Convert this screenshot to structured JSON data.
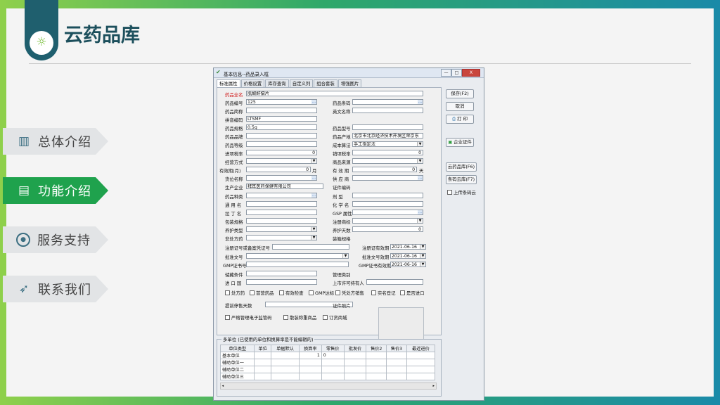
{
  "slide": {
    "app_title": "云药品库",
    "nav": [
      {
        "label": "总体介绍",
        "icon": "bar-chart-icon",
        "active": false
      },
      {
        "label": "功能介绍",
        "icon": "document-icon",
        "active": true
      },
      {
        "label": "服务支持",
        "icon": "target-icon",
        "active": false
      },
      {
        "label": "联系我们",
        "icon": "rocket-icon",
        "active": false
      }
    ]
  },
  "window": {
    "title": "基本信息--药品录入框",
    "tabs": [
      "标准属性",
      "价格设置",
      "库存查询",
      "自定义列",
      "组合套装",
      "增强图片"
    ],
    "fields": {
      "drug_fullname": {
        "label": "药品全名",
        "value": "肌酸酐偿片"
      },
      "drug_code": {
        "label": "药品编号",
        "value": "125"
      },
      "drug_barcode": {
        "label": "药品条码",
        "value": ""
      },
      "drug_shortname": {
        "label": "药品简称",
        "value": ""
      },
      "english_name": {
        "label": "英文名称",
        "value": ""
      },
      "pinyin_code": {
        "label": "拼音编码",
        "value": "LTSMF"
      },
      "spec": {
        "label": "药品规格",
        "value": "0.5g"
      },
      "model": {
        "label": "药品型号",
        "value": ""
      },
      "brand": {
        "label": "药品品牌",
        "value": ""
      },
      "origin": {
        "label": "药品产地",
        "value": "北京市北京经济技术开发区荣京东"
      },
      "grade": {
        "label": "药品等级",
        "value": ""
      },
      "cost_method": {
        "label": "成本算法",
        "value": "手工指定法"
      },
      "input_tax": {
        "label": "进项税率",
        "value": "0"
      },
      "output_tax": {
        "label": "销项税率",
        "value": "0"
      },
      "business_mode": {
        "label": "经营方式",
        "value": ""
      },
      "source": {
        "label": "商品来源",
        "value": ""
      },
      "valid_period": {
        "label": "有效期(月)",
        "value": "0",
        "unit": "月"
      },
      "valid_days": {
        "label": "有 效 期",
        "value": "0",
        "unit": "天"
      },
      "location": {
        "label": "货位名称",
        "value": ""
      },
      "supplier": {
        "label": "供 应 商",
        "value": ""
      },
      "manufacturer": {
        "label": "生产企业",
        "value": "拜耳医药保健有限公司"
      },
      "cert_code": {
        "label": "证件编码",
        "value": ""
      },
      "category": {
        "label": "药品种类",
        "value": ""
      },
      "dosage_form": {
        "label": "剂    型",
        "value": ""
      },
      "generic_name": {
        "label": "通 用 名",
        "value": ""
      },
      "chem_name": {
        "label": "化 学 名",
        "value": ""
      },
      "latin_name": {
        "label": "拉 丁 名",
        "value": ""
      },
      "gsp_attr": {
        "label": "GSP 属性",
        "value": ""
      },
      "package_spec": {
        "label": "包装规格",
        "value": ""
      },
      "trademark": {
        "label": "注册商标",
        "value": ""
      },
      "care_type": {
        "label": "养护类型",
        "value": ""
      },
      "care_days": {
        "label": "养护天数",
        "value": "0"
      },
      "non_rx": {
        "label": "非处方药",
        "value": ""
      },
      "box_spec": {
        "label": "装箱规格",
        "value": ""
      },
      "reg_cert": {
        "label": "注册证号或备案凭证号",
        "value": ""
      },
      "reg_valid": {
        "label": "注册证有效期",
        "value": "2021-06-16"
      },
      "approval_no": {
        "label": "批准文号",
        "value": ""
      },
      "approval_valid": {
        "label": "批准文号效期",
        "value": "2021-06-16"
      },
      "gmp_no": {
        "label": "GMP证书号",
        "value": ""
      },
      "gmp_valid": {
        "label": "GMP证书有效期",
        "value": "2021-06-16"
      },
      "storage": {
        "label": "储藏条件",
        "value": ""
      },
      "mgmt_type": {
        "label": "管理类别",
        "value": ""
      },
      "import_country": {
        "label": "进 口 国",
        "value": ""
      },
      "mah": {
        "label": "上市许可持有人",
        "value": ""
      },
      "alert_days": {
        "label": "提前停售天数",
        "value": ""
      },
      "cert_photo": {
        "label": "证件照片"
      }
    },
    "checks_row1": [
      "处方药",
      "首营药品",
      "有效检查",
      "GMP达标",
      "凭处方销售",
      "实名登记",
      "是否进口"
    ],
    "checks_row2": [
      "严格管理电子监管码",
      "散装称重商品",
      "订货商城"
    ],
    "units_group": {
      "title": "多单位 (已使用的单位和换算率是不能编辑的)",
      "columns": [
        "单位类型",
        "单位",
        "单据默认",
        "换算率",
        "零售价",
        "批发价",
        "",
        "售价2",
        "",
        "售价3",
        "最近进价"
      ],
      "rows": [
        {
          "type": "基本单位",
          "rate": "1",
          "retail": "0"
        },
        {
          "type": "辅助单位一",
          "rate": "",
          "retail": ""
        },
        {
          "type": "辅助单位二",
          "rate": "",
          "retail": ""
        },
        {
          "type": "辅助单位三",
          "rate": "",
          "retail": ""
        }
      ]
    },
    "buttons": {
      "save": "保存(F2)",
      "cancel": "取消",
      "print": "打 印",
      "company_cert": "企业证件",
      "cloud_lib": "云药品库(F6)",
      "barcode_cloud": "条码云库(F7)",
      "upload_barcode": "上传条码云"
    },
    "winbtns": {
      "min": "—",
      "max": "□",
      "close": "X"
    }
  }
}
